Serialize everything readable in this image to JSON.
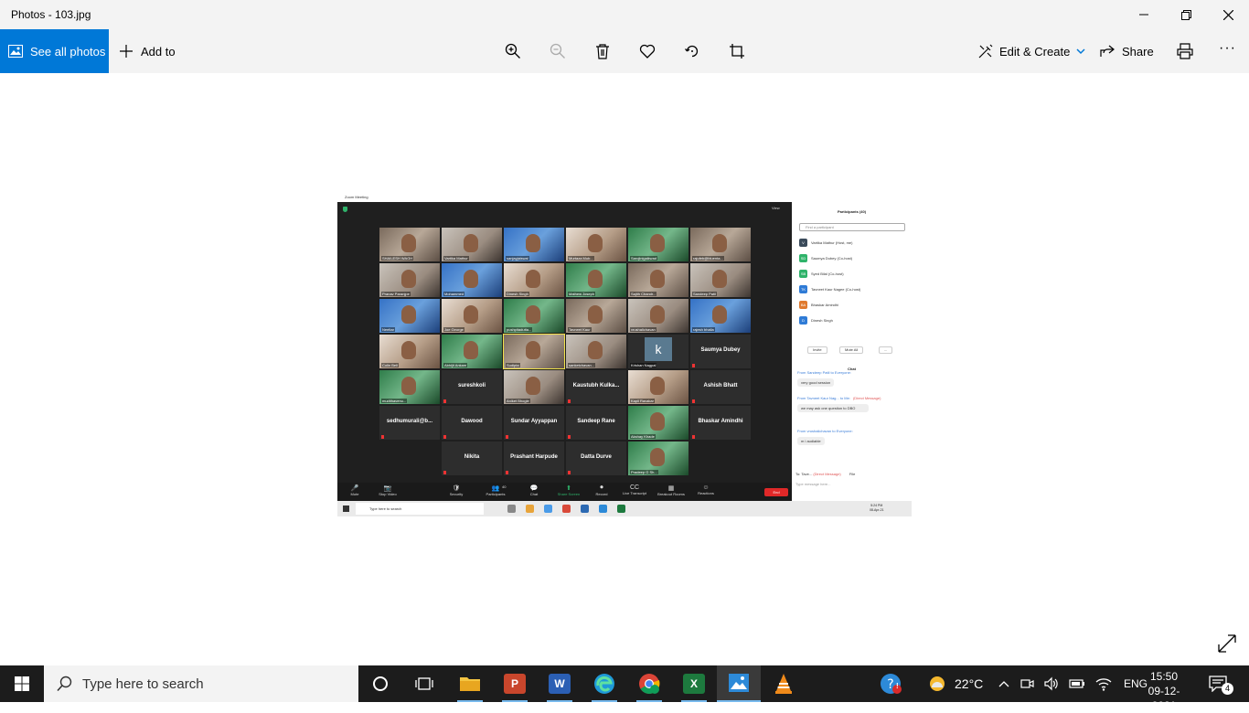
{
  "window": {
    "title": "Photos - 103.jpg",
    "min": "—",
    "max": "❐",
    "close": "✕"
  },
  "toolbar": {
    "see_all": "See all photos",
    "add_to": "Add to",
    "edit_create": "Edit & Create",
    "share": "Share",
    "more": "···",
    "icons": [
      "zoom-in-icon",
      "zoom-out-icon",
      "delete-icon",
      "heart-icon",
      "rotate-icon",
      "crop-icon"
    ]
  },
  "zoom": {
    "title": "Zoom Meeting",
    "view": "View",
    "tiles": [
      {
        "name": "SHAILESH WAGH",
        "type": "video"
      },
      {
        "name": "Vartika Mathur",
        "type": "video"
      },
      {
        "name": "sanjayjaiswal",
        "type": "video"
      },
      {
        "name": "Murtaza Mub...",
        "type": "video"
      },
      {
        "name": "Sarojinigaikwad",
        "type": "video"
      },
      {
        "name": "rajufeb@bluenta...",
        "type": "video"
      },
      {
        "name": "Pranav Paranjpe",
        "type": "video"
      },
      {
        "name": "Mohammed",
        "type": "video"
      },
      {
        "name": "Dinesh Singh",
        "type": "video"
      },
      {
        "name": "Mathew Joseph",
        "type": "video"
      },
      {
        "name": "Sajith Chandr...",
        "type": "video"
      },
      {
        "name": "Sandeep Patil",
        "type": "video"
      },
      {
        "name": "Neeltar",
        "type": "video"
      },
      {
        "name": "Joe George",
        "type": "video"
      },
      {
        "name": "pushpitadutta...",
        "type": "video"
      },
      {
        "name": "Tavneet Kaur",
        "type": "video"
      },
      {
        "name": "vrushalichavan",
        "type": "video"
      },
      {
        "name": "rajesh bhalla",
        "type": "video"
      },
      {
        "name": "Colin Bell",
        "type": "video"
      },
      {
        "name": "Abhijit Ankam",
        "type": "video"
      },
      {
        "name": "Sudipta",
        "type": "video"
      },
      {
        "name": "sanketchavan...",
        "type": "video"
      },
      {
        "name": "Krishan Nagpal",
        "type": "k"
      },
      {
        "name": "Saumya Dubey",
        "type": "name"
      },
      {
        "name": "mudithavenu...",
        "type": "video"
      },
      {
        "name": "sureshkoli",
        "type": "name"
      },
      {
        "name": "Aniket Bhogle",
        "type": "video"
      },
      {
        "name": "Kaustubh  Kulka...",
        "type": "name"
      },
      {
        "name": "Kapil Ravakar",
        "type": "video"
      },
      {
        "name": "Ashish Bhatt",
        "type": "name"
      },
      {
        "name": "sedhumurali@b...",
        "type": "name"
      },
      {
        "name": "Dawood",
        "type": "name"
      },
      {
        "name": "Sundar Ayyappan",
        "type": "name"
      },
      {
        "name": "Sandeep Rane",
        "type": "name"
      },
      {
        "name": "Akshay Khade",
        "type": "video"
      },
      {
        "name": "Bhaskar Amindhi",
        "type": "name"
      },
      {
        "name": "Nikita",
        "type": "name"
      },
      {
        "name": "Prashant Harpude",
        "type": "name"
      },
      {
        "name": "Datta Durve",
        "type": "name"
      },
      {
        "name": "Pradeep G Sh...",
        "type": "video"
      }
    ],
    "controls": [
      "Mute",
      "Stop Video",
      "Security",
      "Participants",
      "Chat",
      "Share Screen",
      "Record",
      "Live Transcript",
      "Breakout Rooms",
      "Reactions"
    ],
    "participants_count": "40",
    "end": "End",
    "side": {
      "title": "Participants (40)",
      "find": "Find a participant",
      "people": [
        {
          "initials": "V",
          "name": "Vartika Mathur (Host, me)",
          "color": "#3a4a5a"
        },
        {
          "initials": "SD",
          "name": "Saumya Dubey (Co-host)",
          "color": "#2fb36a"
        },
        {
          "initials": "SB",
          "name": "Syed Bilal (Co-host)",
          "color": "#2fb36a"
        },
        {
          "initials": "TK",
          "name": "Tavneet Kaur Nagee (Co-host)",
          "color": "#2f7bd6"
        },
        {
          "initials": "BA",
          "name": "Bhaskar Amindhi",
          "color": "#e07a2f"
        },
        {
          "initials": "D",
          "name": "Dinesh Singh",
          "color": "#2f7bd6"
        }
      ],
      "invite": "Invite",
      "mute_all": "Mute All",
      "more": "...",
      "chat_title": "Chat",
      "chat": [
        {
          "from": "From Sandeep Patil to Everyone:",
          "dm": "",
          "msg": "very good session"
        },
        {
          "from": "From Tavneet Kaur Nag... to Me:",
          "dm": "(Direct Message)",
          "msg": "we may ask one question to DBO"
        },
        {
          "from": "From vrushalichavan to Everyone:",
          "dm": "",
          "msg": "m i audiable"
        }
      ],
      "to_label": "To:",
      "to_value": "Tave...",
      "to_dm": "(Direct Message)",
      "file": "File",
      "input_placeholder": "Type message here..."
    },
    "inner_taskbar": {
      "search": "Type here to search",
      "time": "5:24 PM",
      "date": "08-Apr-21"
    }
  },
  "taskbar": {
    "search_placeholder": "Type here to search",
    "weather": "22°C",
    "lang": "ENG",
    "time": "15:50",
    "date": "09-12-2021",
    "notifications": "4",
    "help_badge": "!"
  }
}
